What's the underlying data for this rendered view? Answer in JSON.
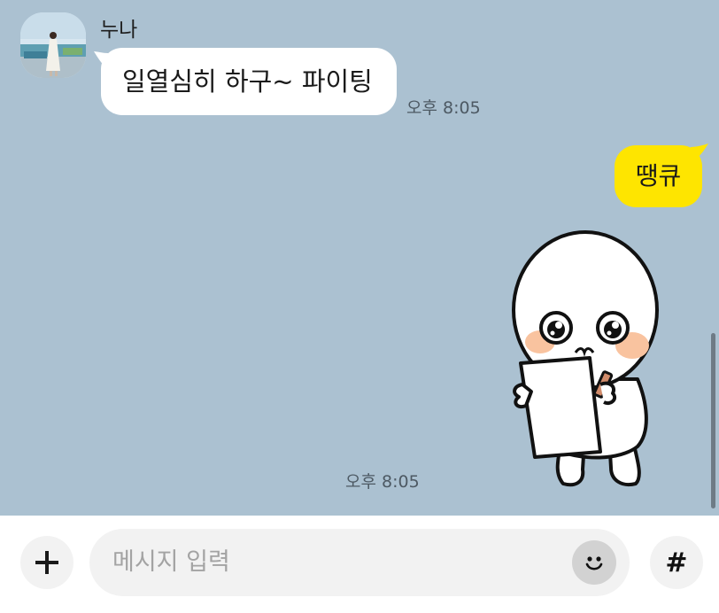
{
  "chat": {
    "sender_name": "누나",
    "messages": [
      {
        "from": "other",
        "text": "일열심히 하구~ 파이팅",
        "time": "오후 8:05"
      },
      {
        "from": "me",
        "text": "땡큐"
      },
      {
        "from": "me",
        "type": "sticker",
        "icon": "reading-character-sticker",
        "time": "오후 8:05"
      }
    ]
  },
  "input_bar": {
    "plus_icon": "plus-icon",
    "placeholder": "메시지 입력",
    "emoji_icon": "smiley-icon",
    "hash_label": "#"
  },
  "colors": {
    "chat_background": "#abc1d1",
    "incoming_bubble": "#ffffff",
    "outgoing_bubble": "#fee500"
  }
}
